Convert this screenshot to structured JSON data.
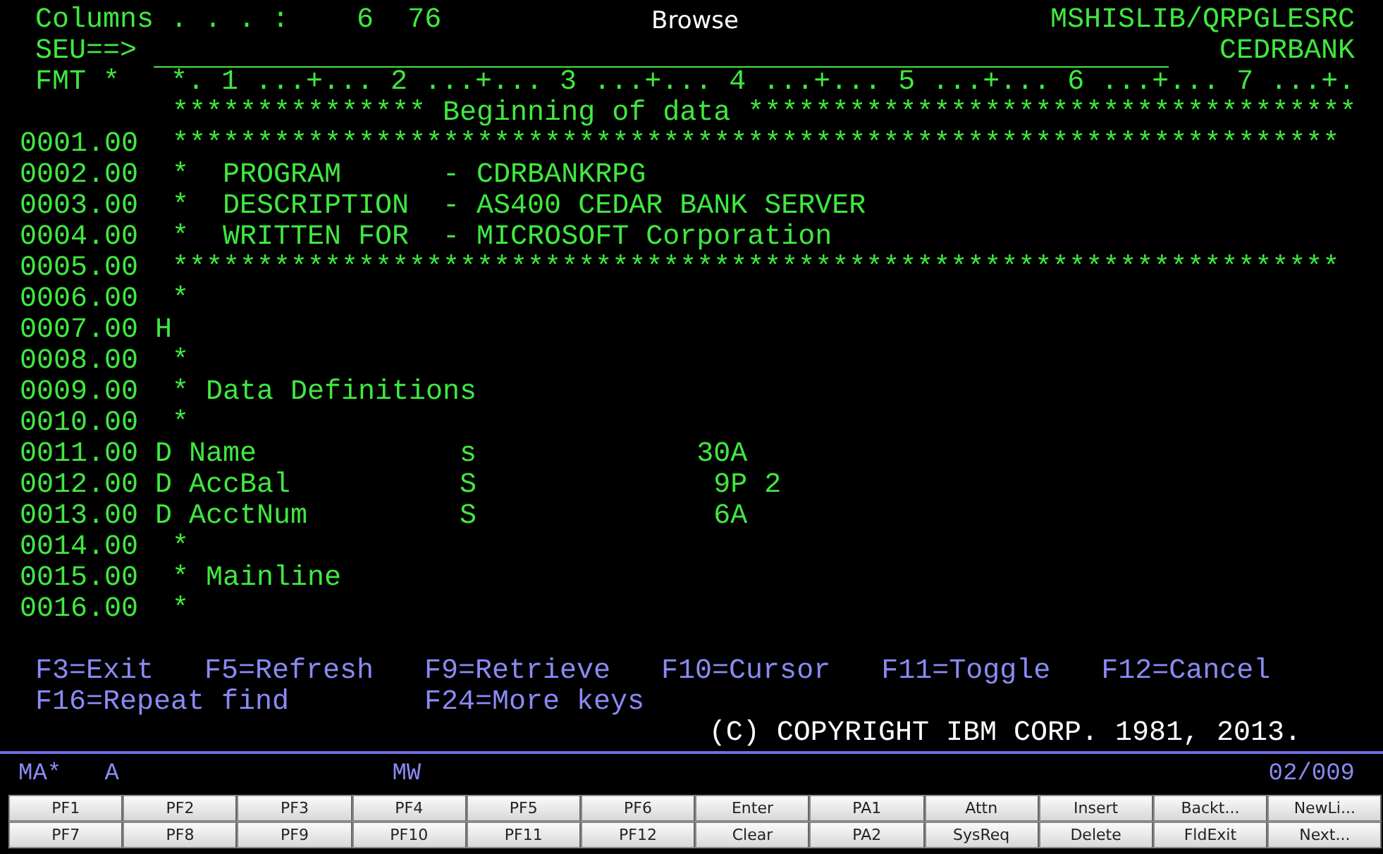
{
  "header": {
    "columns_label": "Columns . . . :",
    "column_from": "6",
    "column_to": "76",
    "mode": "Browse",
    "source_file": "MSHISLIB/QRPGLESRC",
    "command_prompt": "SEU==>",
    "member": "CEDRBANK",
    "format_label": "FMT *",
    "ruler": "*. 1 ...+... 2 ...+... 3 ...+... 4 ...+... 5 ...+... 6 ...+... 7 ...+.",
    "begin_marker": " *************** Beginning of data ************************************"
  },
  "source_lines": [
    {
      "seq": "0001.00",
      "text": " *********************************************************************"
    },
    {
      "seq": "0002.00",
      "text": " *  PROGRAM      - CDRBANKRPG"
    },
    {
      "seq": "0003.00",
      "text": " *  DESCRIPTION  - AS400 CEDAR BANK SERVER"
    },
    {
      "seq": "0004.00",
      "text": " *  WRITTEN FOR  - MICROSOFT Corporation"
    },
    {
      "seq": "0005.00",
      "text": " *********************************************************************"
    },
    {
      "seq": "0006.00",
      "text": " *"
    },
    {
      "seq": "0007.00",
      "text": "H"
    },
    {
      "seq": "0008.00",
      "text": " *"
    },
    {
      "seq": "0009.00",
      "text": " * Data Definitions"
    },
    {
      "seq": "0010.00",
      "text": " *"
    },
    {
      "seq": "0011.00",
      "text": "D Name            s             30A"
    },
    {
      "seq": "0012.00",
      "text": "D AccBal          S              9P 2"
    },
    {
      "seq": "0013.00",
      "text": "D AcctNum         S              6A"
    },
    {
      "seq": "0014.00",
      "text": " *"
    },
    {
      "seq": "0015.00",
      "text": " * Mainline"
    },
    {
      "seq": "0016.00",
      "text": " *"
    }
  ],
  "function_keys": [
    [
      "F3=Exit",
      "F5=Refresh",
      "F9=Retrieve",
      "F10=Cursor",
      "F11=Toggle",
      "F12=Cancel"
    ],
    [
      "F16=Repeat find",
      "F24=More keys"
    ]
  ],
  "copyright": "(C) COPYRIGHT IBM CORP. 1981, 2013.",
  "status_bar": {
    "field_1": "MA*",
    "field_2": "A",
    "field_3": "MW",
    "cursor_position": "02/009"
  },
  "keypad": [
    [
      "PF1",
      "PF2",
      "PF3",
      "PF4",
      "PF5",
      "PF6",
      "Enter",
      "PA1",
      "Attn",
      "Insert",
      "Backt...",
      "NewLi..."
    ],
    [
      "PF7",
      "PF8",
      "PF9",
      "PF10",
      "PF11",
      "PF12",
      "Clear",
      "PA2",
      "SysReq",
      "Delete",
      "FldExit",
      "Next..."
    ]
  ]
}
